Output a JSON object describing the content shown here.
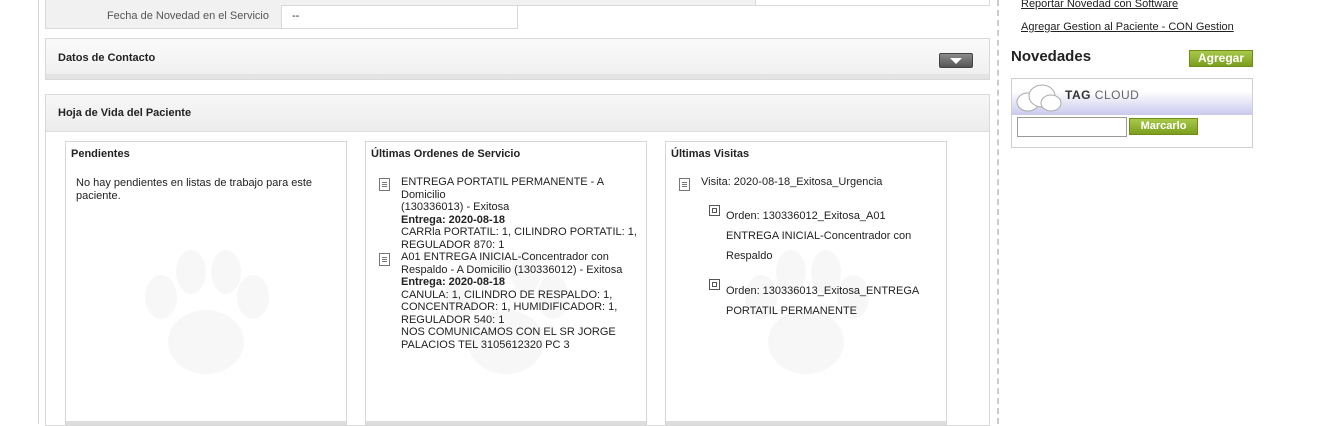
{
  "top_table": {
    "novedad_label": "Fecha de Novedad en el Servicio",
    "novedad_value": "--"
  },
  "sections": {
    "contacto_title": "Datos de Contacto",
    "hoja_title": "Hoja de Vida del Paciente"
  },
  "pendientes": {
    "title": "Pendientes",
    "message": "No hay pendientes en listas de trabajo para este paciente."
  },
  "ordenes": {
    "title": "Últimas Ordenes de Servicio",
    "items": [
      {
        "line1": "ENTREGA PORTATIL PERMANENTE - A Domicilio",
        "line2": "(130336013) - Exitosa",
        "entrega": "Entrega: 2020-08-18",
        "d1": "CARRla PORTATIL: 1, CILINDRO PORTATIL: 1,",
        "d2": "REGULADOR 870: 1"
      },
      {
        "line1": "A01 ENTREGA INICIAL-Concentrador con",
        "line2": "Respaldo - A Domicilio (130336012) - Exitosa",
        "entrega": "Entrega: 2020-08-18",
        "d1": "CANULA: 1, CILINDRO DE RESPALDO: 1,",
        "d2": "CONCENTRADOR: 1, HUMIDIFICADOR: 1,",
        "d3": "REGULADOR 540: 1",
        "d4": "NOS COMUNICAMOS CON EL SR JORGE",
        "d5": "PALACIOS TEL 3105612320 PC 3"
      }
    ]
  },
  "visitas": {
    "title": "Últimas Visitas",
    "visit": "Visita: 2020-08-18_Exitosa_Urgencia",
    "orden1_l1": "Orden: 130336012_Exitosa_A01",
    "orden1_l2": "ENTREGA INICIAL-Concentrador con",
    "orden1_l3": "Respaldo",
    "orden2_l1": "Orden: 130336013_Exitosa_ENTREGA",
    "orden2_l2": "PORTATIL PERMANENTE"
  },
  "sidebar": {
    "link1": "Reportar Novedad con Software",
    "link2": "Agregar Gestion al Paciente - CON Gestion",
    "novedades_title": "Novedades",
    "agregar_label": "Agregar",
    "tag_word1": "TAG",
    "tag_word2": "CLOUD",
    "marcar_label": "Marcarlo",
    "tag_input_value": ""
  },
  "colors": {
    "button_green": "#8db32f",
    "tag_gradient": "#c9c9ee"
  }
}
